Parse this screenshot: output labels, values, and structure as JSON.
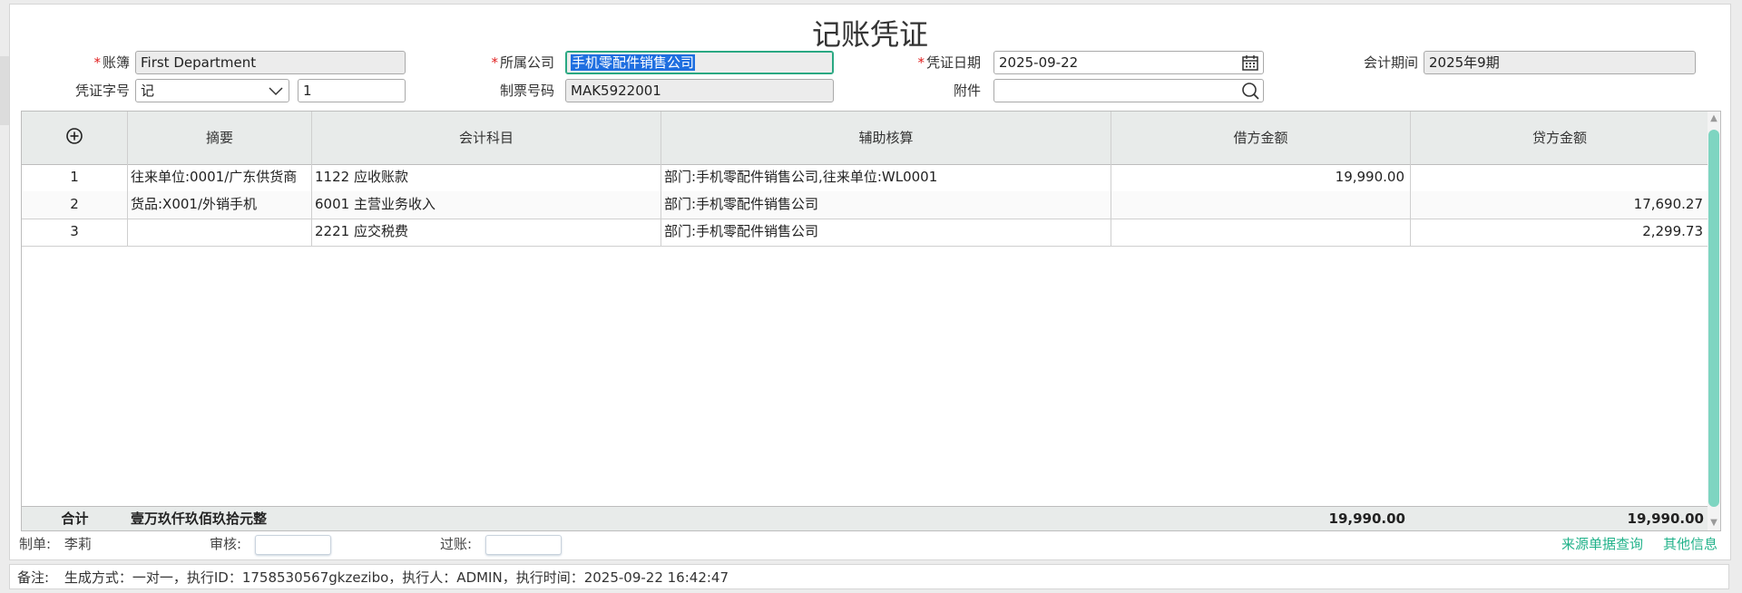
{
  "side_toggle_icon": "swap-arrows-icon",
  "title": "记账凭证",
  "form": {
    "ledger_label": "账簿",
    "ledger_value": "First Department",
    "company_label": "所属公司",
    "company_value": "手机零配件销售公司",
    "voucher_date_label": "凭证日期",
    "voucher_date_value": "2025-09-22",
    "period_label": "会计期间",
    "period_value": "2025年9期",
    "voucher_word_label": "凭证字号",
    "voucher_word_value": "记",
    "voucher_no_value": "1",
    "bill_no_label": "制票号码",
    "bill_no_value": "MAK5922001",
    "attachment_label": "附件",
    "attachment_value": ""
  },
  "table": {
    "headers": [
      "摘要",
      "会计科目",
      "辅助核算",
      "借方金额",
      "贷方金额"
    ],
    "rows": [
      {
        "no": "1",
        "summary": "往来单位:0001/广东供货商",
        "account": "1122 应收账款",
        "aux": "部门:手机零配件销售公司,往来单位:WL0001",
        "debit": "19,990.00",
        "credit": ""
      },
      {
        "no": "2",
        "summary": "货品:X001/外销手机",
        "account": "6001 主营业务收入",
        "aux": "部门:手机零配件销售公司",
        "debit": "",
        "credit": "17,690.27"
      },
      {
        "no": "3",
        "summary": "",
        "account": "2221 应交税费",
        "aux": "部门:手机零配件销售公司",
        "debit": "",
        "credit": "2,299.73"
      }
    ],
    "total_label": "合计",
    "total_words": "壹万玖仟玖佰玖拾元整",
    "total_debit": "19,990.00",
    "total_credit": "19,990.00"
  },
  "footer": {
    "maker_label": "制单:",
    "maker_value": "李莉",
    "audit_label": "审核:",
    "post_label": "过账:",
    "source_query_link": "来源单据查询",
    "other_info_link": "其他信息"
  },
  "remark": {
    "label": "备注:",
    "text": "生成方式：一对一，执行ID：1758530567gkzezibo，执行人：ADMIN，执行时间：2025-09-22 16:42:47"
  }
}
